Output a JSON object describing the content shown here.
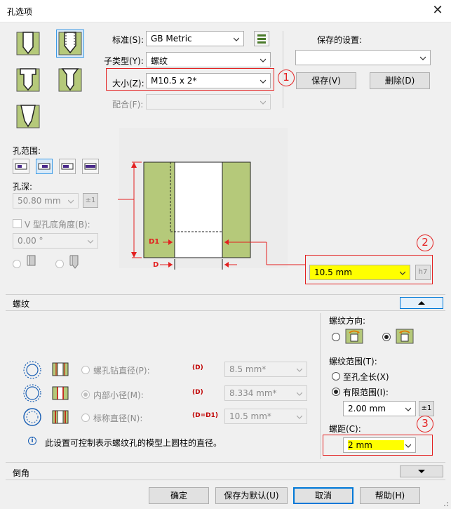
{
  "window": {
    "title": "孔选项",
    "close_glyph": "✕"
  },
  "top": {
    "standard_label": "标准(S):",
    "standard_value": "GB Metric",
    "subtype_label": "子类型(Y):",
    "subtype_value": "螺纹",
    "size_label": "大小(Z):",
    "size_value": "M10.5 x 2*",
    "fit_label": "配合(F):",
    "fit_value": ""
  },
  "saved": {
    "label": "保存的设置:",
    "value": "",
    "save_button": "保存(V)",
    "delete_button": "删除(D)"
  },
  "callouts": {
    "one": "1",
    "two": "2",
    "three": "3"
  },
  "hole_range": {
    "label": "孔范围:",
    "depth_label": "孔深:",
    "depth_value": "50.80 mm",
    "tol_button": "±1",
    "v_angle_label": "V 型孔底角度(B):",
    "v_angle_value": "0.00 °"
  },
  "diagram": {
    "d1_label": "D1",
    "d_label": "D",
    "size_value": "10.5 mm",
    "fit_tag": "h7"
  },
  "thread_section": {
    "header": "螺纹",
    "tap_drill_label": "螺孔钻直径(P):",
    "tap_drill_code": "(D)",
    "tap_drill_value": "8.5 mm*",
    "minor_label": "内部小径(M):",
    "minor_code": "(D)",
    "minor_value": "8.334 mm*",
    "nominal_label": "标称直径(N):",
    "nominal_code": "(D=D1)",
    "nominal_value": "10.5 mm*",
    "info_glyph": "i",
    "info_text": "此设置可控制表示螺纹孔的模型上圆柱的直径。",
    "direction_label": "螺纹方向:",
    "range_label": "螺纹范围(T):",
    "full_length_label": "至孔全长(X)",
    "limited_label": "有限范围(I):",
    "limited_value": "2.00 mm",
    "limited_tol": "±1",
    "pitch_label": "螺距(C):",
    "pitch_value": "2 mm"
  },
  "chamfer_section": {
    "header": "倒角"
  },
  "footer": {
    "ok": "确定",
    "save_default": "保存为默认(U)",
    "cancel": "取消",
    "help": "帮助(H)"
  },
  "colors": {
    "hatch": "#b5c97a",
    "callout": "#e32020",
    "highlight": "#ffff00",
    "selected": "#d9eaf8"
  }
}
